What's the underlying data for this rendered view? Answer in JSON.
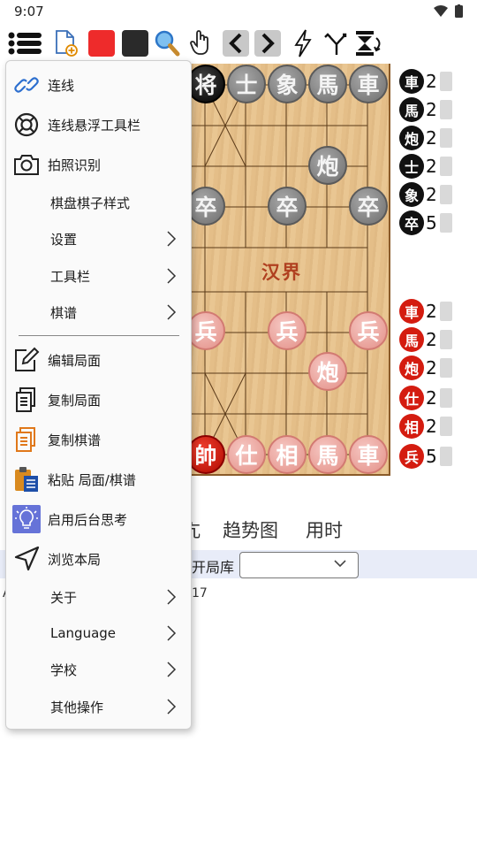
{
  "status_bar": {
    "time": "9:07"
  },
  "toolbar": {
    "items": [
      "menu-icon",
      "new-file-icon",
      "red-color-icon",
      "black-color-icon",
      "search-icon",
      "hand-icon",
      "back-icon",
      "forward-icon",
      "flash-icon",
      "branch-icon",
      "flip-icon"
    ],
    "colors": {
      "red": "#ee2b2b",
      "black": "#2a2a2a",
      "nav_bg": "#c8c8c8"
    }
  },
  "board": {
    "river_text": "汉界",
    "black_pieces": [
      {
        "char": "将",
        "king": true
      },
      {
        "char": "士"
      },
      {
        "char": "象"
      },
      {
        "char": "馬"
      },
      {
        "char": "車"
      },
      {
        "char": "炮"
      },
      {
        "char": "卒"
      },
      {
        "char": "卒"
      },
      {
        "char": "卒"
      }
    ],
    "red_pieces": [
      {
        "char": "兵"
      },
      {
        "char": "兵"
      },
      {
        "char": "兵"
      },
      {
        "char": "炮"
      },
      {
        "char": "帥",
        "king": true
      },
      {
        "char": "仕"
      },
      {
        "char": "相"
      },
      {
        "char": "馬"
      },
      {
        "char": "車"
      }
    ]
  },
  "captured": {
    "black": [
      {
        "char": "車",
        "count": "2"
      },
      {
        "char": "馬",
        "count": "2"
      },
      {
        "char": "炮",
        "count": "2"
      },
      {
        "char": "士",
        "count": "2"
      },
      {
        "char": "象",
        "count": "2"
      },
      {
        "char": "卒",
        "count": "5"
      }
    ],
    "red": [
      {
        "char": "車",
        "count": "2"
      },
      {
        "char": "馬",
        "count": "2"
      },
      {
        "char": "炮",
        "count": "2"
      },
      {
        "char": "仕",
        "count": "2"
      },
      {
        "char": "相",
        "count": "2"
      },
      {
        "char": "兵",
        "count": "5"
      }
    ]
  },
  "tabs": {
    "partial": "亢",
    "trend": "趋势图",
    "time": "用时"
  },
  "opening": {
    "label": "开局库",
    "selected": ""
  },
  "info_text": "17",
  "bg_letter": "A",
  "menu": {
    "items": [
      {
        "label": "连线",
        "icon": "link-icon"
      },
      {
        "label": "连线悬浮工具栏",
        "icon": "lifebuoy-icon"
      },
      {
        "label": "拍照识别",
        "icon": "camera-icon"
      },
      {
        "label": "棋盘棋子样式"
      },
      {
        "label": "设置",
        "submenu": true
      },
      {
        "label": "工具栏",
        "submenu": true
      },
      {
        "label": "棋谱",
        "submenu": true
      },
      {
        "label": "编辑局面",
        "icon": "edit-icon"
      },
      {
        "label": "复制局面",
        "icon": "copy-position-icon"
      },
      {
        "label": "复制棋谱",
        "icon": "copy-record-icon"
      },
      {
        "label": "粘贴 局面/棋谱",
        "icon": "paste-icon"
      },
      {
        "label": "启用后台思考",
        "icon": "bulb-icon"
      },
      {
        "label": "浏览本局",
        "icon": "navigate-icon"
      },
      {
        "label": "关于",
        "submenu": true
      },
      {
        "label": "Language",
        "submenu": true
      },
      {
        "label": "学校",
        "submenu": true
      },
      {
        "label": "其他操作",
        "submenu": true
      }
    ]
  }
}
